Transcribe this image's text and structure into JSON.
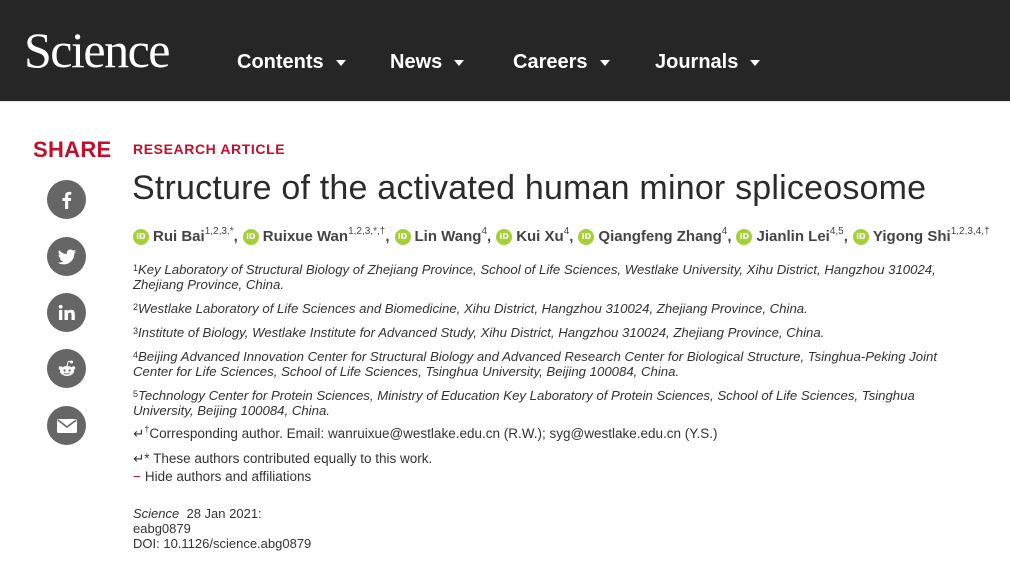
{
  "header": {
    "logo": "Science",
    "nav": [
      {
        "label": "Contents"
      },
      {
        "label": "News"
      },
      {
        "label": "Careers"
      },
      {
        "label": "Journals"
      }
    ]
  },
  "share": {
    "title": "SHARE",
    "buttons": [
      "facebook-icon",
      "twitter-icon",
      "linkedin-icon",
      "reddit-icon",
      "email-icon"
    ]
  },
  "article": {
    "kicker": "RESEARCH ARTICLE",
    "title": "Structure of the activated human minor spliceosome",
    "authors": [
      {
        "name": "Rui Bai",
        "sup": "1,2,3,*"
      },
      {
        "name": "Ruixue Wan",
        "sup": "1,2,3,*,†"
      },
      {
        "name": "Lin Wang",
        "sup": "4"
      },
      {
        "name": "Kui Xu",
        "sup": "4"
      },
      {
        "name": "Qiangfeng Zhang",
        "sup": "4"
      },
      {
        "name": "Jianlin Lei",
        "sup": "4,5"
      },
      {
        "name": "Yigong Shi",
        "sup": "1,2,3,4,†"
      }
    ],
    "affiliations": [
      {
        "num": "1",
        "text": "Key Laboratory of Structural Biology of Zhejiang Province, School of Life Sciences, Westlake University, Xihu District, Hangzhou 310024, Zhejiang Province, China."
      },
      {
        "num": "2",
        "text": "Westlake Laboratory of Life Sciences and Biomedicine, Xihu District, Hangzhou 310024, Zhejiang Province, China."
      },
      {
        "num": "3",
        "text": "Institute of Biology, Westlake Institute for Advanced Study, Xihu District, Hangzhou 310024, Zhejiang Province, China."
      },
      {
        "num": "4",
        "text": "Beijing Advanced Innovation Center for Structural Biology and Advanced Research Center for Biological Structure, Tsinghua-Peking Joint Center for Life Sciences, School of Life Sciences, Tsinghua University, Beijing 100084, China."
      },
      {
        "num": "5",
        "text": "Technology Center for Protein Sciences, Ministry of Education Key Laboratory of Protein Sciences, School of Life Sciences, Tsinghua University, Beijing 100084, China."
      }
    ],
    "corresponding": {
      "arrow": "↵",
      "mark": "†",
      "prefix": "Corresponding author. Email: ",
      "email1": "wanruixue@westlake.edu.cn",
      "mid": " (R.W.); ",
      "email2": "syg@westlake.edu.cn",
      "suffix": " (Y.S.)"
    },
    "equal_note": "↵* These authors contributed equally to this work.",
    "hide_toggle": {
      "symbol": "−",
      "label": "Hide authors and affiliations"
    },
    "meta": {
      "journal": "Science",
      "date": "28 Jan 2021:",
      "id": "eabg0879",
      "doi": "DOI: 10.1126/science.abg0879"
    }
  },
  "colors": {
    "header_bg": "#262626",
    "accent": "#c0102b",
    "orcid": "#a6ce39",
    "share_icon_bg": "#666666"
  }
}
